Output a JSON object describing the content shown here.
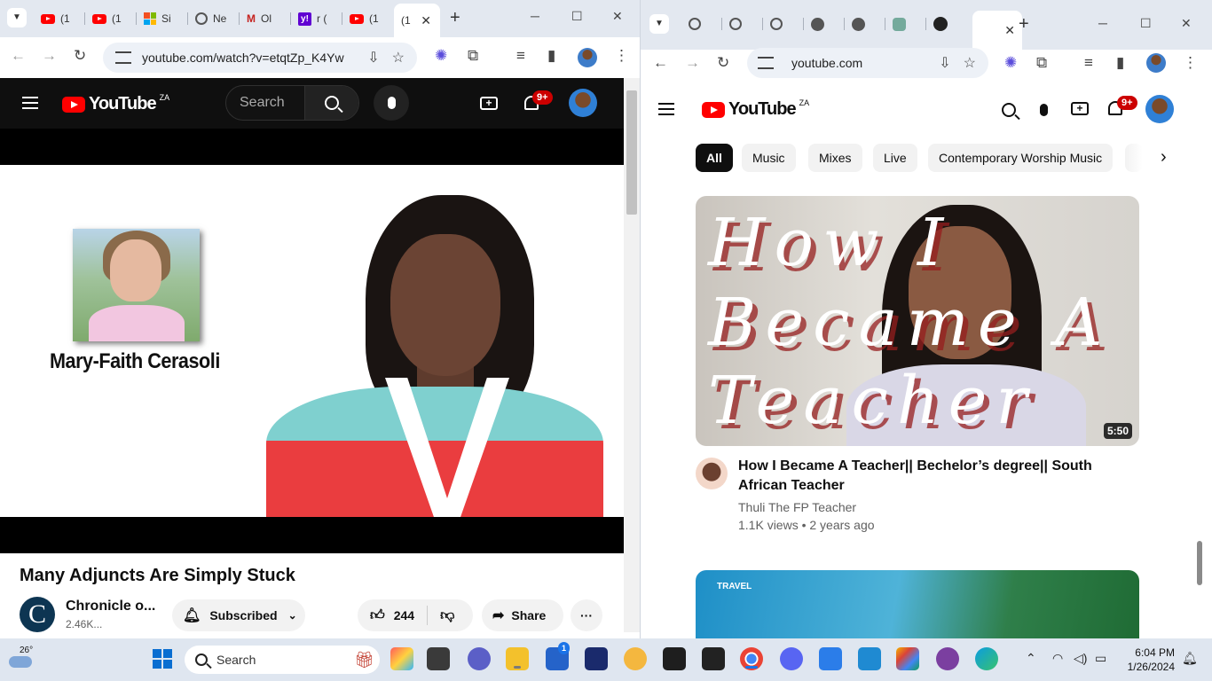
{
  "left_window": {
    "tabs": [
      {
        "label": "(1",
        "favicon": "youtube"
      },
      {
        "label": "(1",
        "favicon": "youtube"
      },
      {
        "label": "Si",
        "favicon": "microsoft"
      },
      {
        "label": "Ne",
        "favicon": "globe"
      },
      {
        "label": "Ol",
        "favicon": "gmail"
      },
      {
        "label": "r (",
        "favicon": "yahoo"
      },
      {
        "label": "(1",
        "favicon": "youtube"
      },
      {
        "label": "(1",
        "favicon": "youtube",
        "active": true
      }
    ],
    "url": "youtube.com/watch?v=etqtZp_K4Yw",
    "youtube": {
      "search_placeholder": "Search",
      "logo_text": "YouTube",
      "region": "ZA",
      "notifications_badge": "9+"
    },
    "video": {
      "overlay_name": "Mary-Faith Cerasoli",
      "title": "Many Adjuncts Are Simply Stuck",
      "channel_name": "Chronicle o...",
      "channel_avatar_letter": "C",
      "subscribers": "2.46K...",
      "subscribe_label": "Subscribed",
      "likes": "244",
      "share_label": "Share"
    }
  },
  "right_window": {
    "url": "youtube.com",
    "youtube": {
      "logo_text": "YouTube",
      "region": "ZA",
      "notifications_badge": "9+"
    },
    "chips": [
      "All",
      "Music",
      "Mixes",
      "Live",
      "Contemporary Worship Music"
    ],
    "videos": [
      {
        "thumbnail_text": [
          "How I",
          "Became A",
          "Teacher"
        ],
        "duration": "5:50",
        "title": "How I Became A Teacher|| Bechelor’s degree|| South African Teacher",
        "channel": "Thuli The FP Teacher",
        "meta": "1.1K views • 2 years ago"
      },
      {
        "thumbnail_tag": "TRAVEL"
      }
    ]
  },
  "taskbar": {
    "weather_temp": "26°",
    "search_placeholder": "Search",
    "time": "6:04 PM",
    "date": "1/26/2024",
    "store_badge": "1"
  },
  "colors": {
    "youtube_red": "#ff0000",
    "badge_red": "#cc0000",
    "taskbar_bg": "#dfe6f0"
  }
}
